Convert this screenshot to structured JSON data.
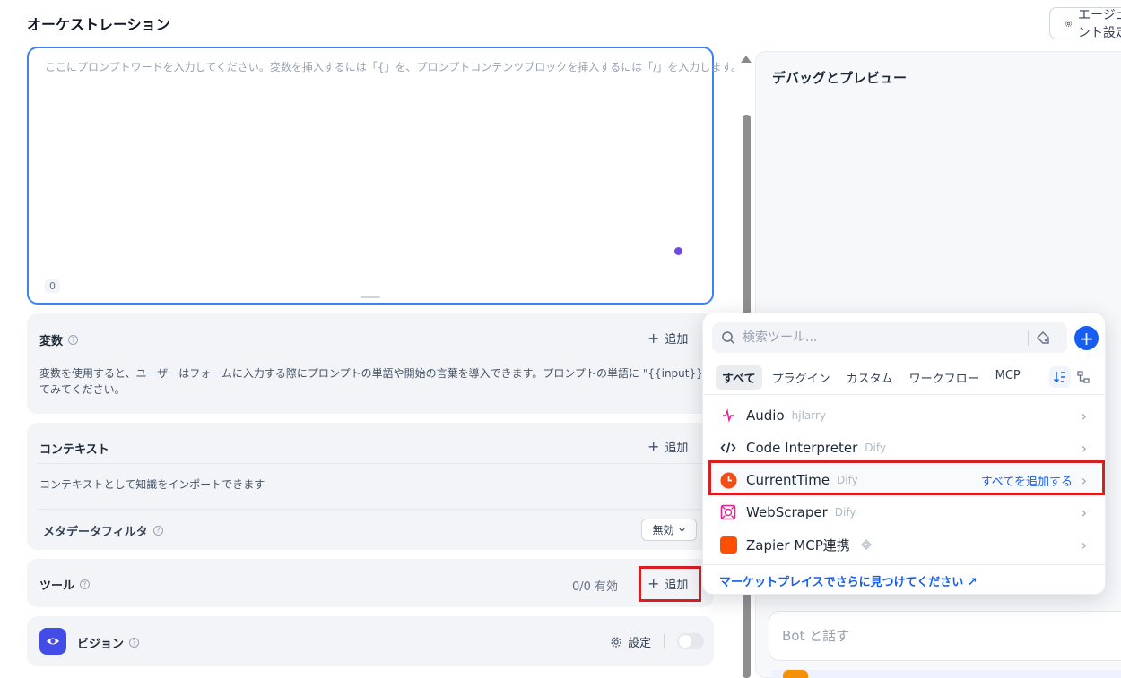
{
  "page": {
    "title": "オーケストレーション",
    "agent_button_label": "エージェント設定"
  },
  "prompt": {
    "placeholder": "ここにプロンプトワードを入力してください。変数を挿入するには「{」を、プロンプトコンテンツブロックを挿入するには「/」を入力します。",
    "char_count": "0"
  },
  "variables": {
    "title": "変数",
    "add_label": "追加",
    "description_line1": "変数を使用すると、ユーザーはフォームに入力する際にプロンプトの単語や開始の言葉を導入できます。プロンプトの単語に \"{{input}}\" を入力し",
    "description_line2": "てみてください。"
  },
  "context": {
    "title": "コンテキスト",
    "add_label": "追加",
    "description": "コンテキストとして知識をインポートできます",
    "metadata_filter_label": "メタデータフィルタ",
    "metadata_filter_value": "無効"
  },
  "tools": {
    "title": "ツール",
    "status": "0/0 有効",
    "add_label": "追加"
  },
  "vision": {
    "title": "ビジョン",
    "settings_label": "設定",
    "enabled": false
  },
  "debug": {
    "title": "デバッグとプレビュー",
    "chat_placeholder": "Bot と話す"
  },
  "tool_picker": {
    "search_placeholder": "検索ツール...",
    "tabs": [
      "すべて",
      "プラグイン",
      "カスタム",
      "ワークフロー",
      "MCP"
    ],
    "active_tab": "すべて",
    "items": [
      {
        "name": "Audio",
        "author": "hjlarry",
        "icon": "audio-icon"
      },
      {
        "name": "Code Interpreter",
        "author": "Dify",
        "icon": "code-icon"
      },
      {
        "name": "CurrentTime",
        "author": "Dify",
        "icon": "clock-icon",
        "action_label": "すべてを追加する"
      },
      {
        "name": "WebScraper",
        "author": "Dify",
        "icon": "web-icon"
      },
      {
        "name": "Zapier MCP連携",
        "author": "",
        "icon": "zapier-icon"
      }
    ],
    "marketplace_label": "マーケットプレイスでさらに見つけてください ↗"
  },
  "colors": {
    "accent": "#155eef",
    "highlight": "#d81e23",
    "focus": "#3b82f6"
  }
}
